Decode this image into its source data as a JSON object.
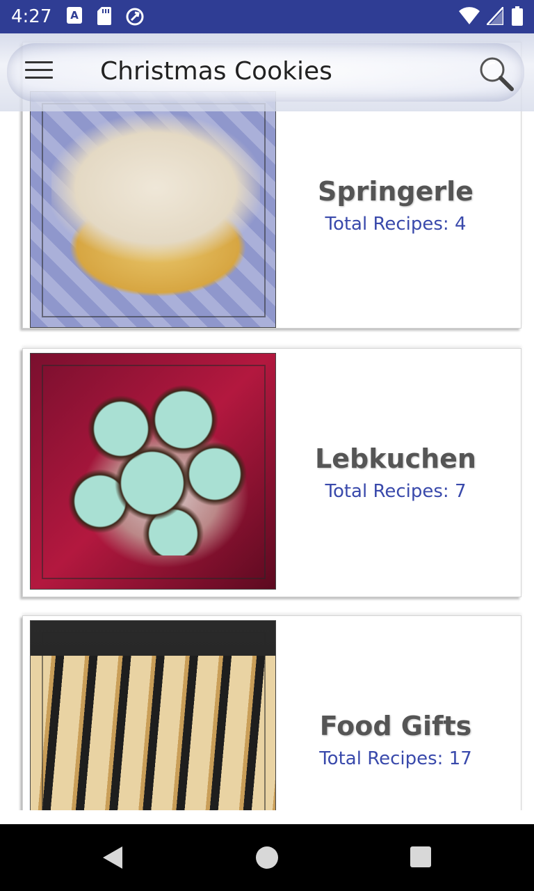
{
  "status_bar": {
    "time": "4:27",
    "icons": [
      "font-download-icon",
      "sd-card-icon",
      "sync-icon",
      "wifi-icon",
      "signal-icon",
      "battery-icon"
    ],
    "font_icon_letter": "A"
  },
  "toolbar": {
    "title": "Christmas Cookies",
    "menu_icon": "hamburger-menu-icon",
    "search_icon": "magnifier-icon"
  },
  "categories": [
    {
      "name": "Springerle",
      "count_label": "Total Recipes: 4",
      "image": "springerle-cookies-photo"
    },
    {
      "name": "Lebkuchen",
      "count_label": "Total Recipes: 7",
      "image": "lebkuchen-cookies-photo"
    },
    {
      "name": "Food Gifts",
      "count_label": "Total Recipes: 17",
      "image": "biscotti-photo"
    }
  ],
  "nav_bar": {
    "buttons": [
      "back-icon",
      "home-icon",
      "recents-icon"
    ]
  },
  "colors": {
    "status_bar": "#2f3d94",
    "count_text": "#3949ab",
    "name_text": "#555555",
    "nav_bar": "#000000"
  }
}
